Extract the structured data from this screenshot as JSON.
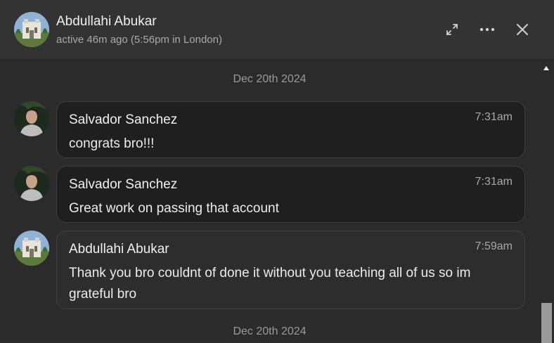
{
  "header": {
    "name": "Abdullahi Abukar",
    "status": "active 46m ago (5:56pm in London)",
    "icons": [
      "expand-icon",
      "more-options-icon",
      "close-icon"
    ]
  },
  "dates": [
    "Dec 20th 2024",
    "Dec 20th 2024"
  ],
  "messages": [
    {
      "sender": "Salvador Sanchez",
      "time": "7:31am",
      "text": "congrats bro!!!"
    },
    {
      "sender": "Salvador Sanchez",
      "time": "7:31am",
      "text": "Great work on passing that account"
    },
    {
      "sender": "Abdullahi Abukar",
      "time": "7:59am",
      "text": "Thank you bro couldnt of done it without you teaching all of us so im grateful bro"
    }
  ],
  "colors": {
    "background": "#2b2b2b",
    "header": "#333333",
    "bubble": "#1f1f1f"
  }
}
